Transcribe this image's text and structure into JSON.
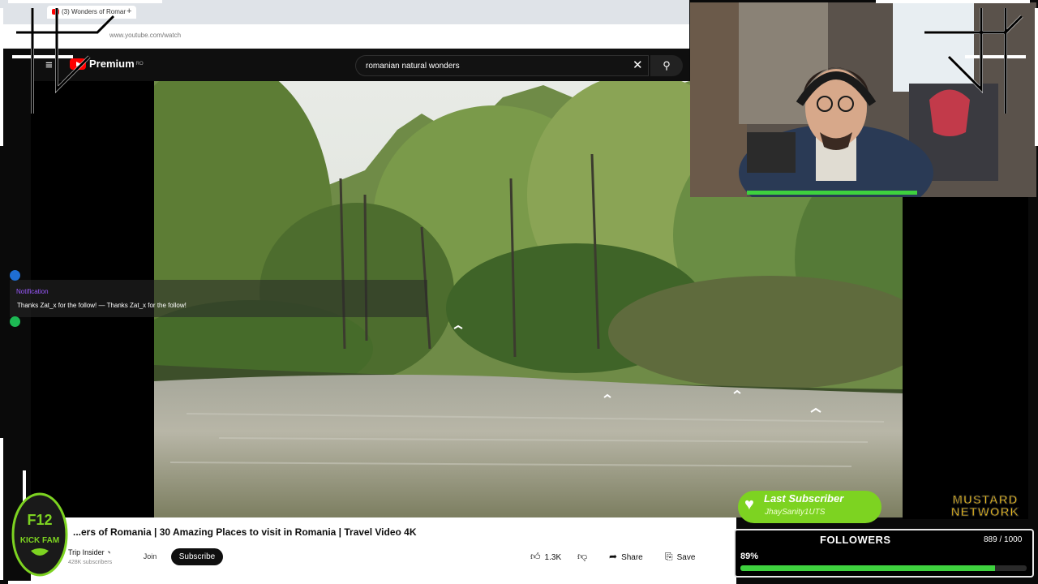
{
  "browser": {
    "tab_title": "(3) Wonders of Romar",
    "url": "www.youtube.com/watch"
  },
  "youtube": {
    "logo_text": "Premium",
    "logo_region": "RO",
    "search_value": "romanian natural wonders"
  },
  "video": {
    "title": "...ers of Romania | 30 Amazing Places to visit in Romania | Travel Video 4K",
    "channel": "Trip Insider",
    "subscribers": "428K subscribers",
    "join_label": "Join",
    "subscribe_label": "Subscribe",
    "likes": "1.3K",
    "share_label": "Share",
    "save_label": "Save"
  },
  "notification": {
    "title": "Notification",
    "text": "Thanks Zat_x for the follow! — Thanks Zat_x for the follow!"
  },
  "overlay": {
    "last_subscriber_title": "Last Subscriber",
    "last_subscriber_name": "JhaySanity1UTS",
    "brand_line1": "MUSTARD",
    "brand_line2": "NETWORK",
    "badge_line1": "F12",
    "badge_line2": "KICK FAM",
    "followers_label": "FOLLOWERS",
    "followers_count": "889 / 1000",
    "followers_percent_label": "89%",
    "followers_fraction": 0.889
  },
  "colors": {
    "accent_green": "#7dd321",
    "progress_green": "#3ed13e",
    "brand_yellow": "#f3c11b",
    "youtube_red": "#ff0000",
    "notification_purple": "#9b59ff"
  },
  "icons": [
    "menu-icon",
    "close-icon",
    "search-icon",
    "like-icon",
    "dislike-icon",
    "share-icon",
    "save-icon",
    "heart-icon",
    "verified-icon"
  ]
}
